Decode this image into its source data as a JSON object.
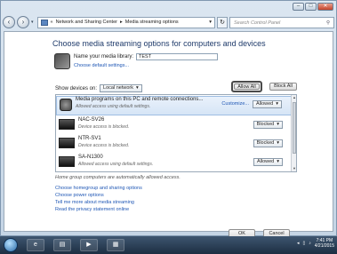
{
  "breadcrumb": {
    "sep": "«",
    "items": [
      "Network and Sharing Center",
      "Media streaming options"
    ],
    "arrow": "▸"
  },
  "search": {
    "placeholder": "Search Control Panel"
  },
  "heading": "Choose media streaming options for computers and devices",
  "library": {
    "label": "Name your media library:",
    "value": "TEST",
    "defaults_link": "Choose default settings..."
  },
  "show_devices": {
    "label": "Show devices on:",
    "value": "Local network"
  },
  "buttons": {
    "allow_all": "Allow All",
    "block_all": "Block All",
    "ok": "OK",
    "cancel": "Cancel"
  },
  "devices": [
    {
      "name": "Media programs on this PC and remote connections...",
      "sub": "Allowed access using default settings.",
      "customize": "Customize...",
      "status": "Allowed"
    },
    {
      "name": "NAC-SV26",
      "sub": "Device access is blocked.",
      "status": "Blocked"
    },
    {
      "name": "NTR-SV1",
      "sub": "Device access is blocked.",
      "status": "Blocked"
    },
    {
      "name": "SA-N1300",
      "sub": "Allowed access using default settings.",
      "status": "Allowed"
    }
  ],
  "note": "Home group computers are automatically allowed access.",
  "links": [
    "Choose homegroup and sharing options",
    "Choose power options",
    "Tell me more about media streaming",
    "Read the privacy statement online"
  ],
  "clock": {
    "time": "7:41 PM",
    "date": "4/21/2015"
  },
  "icons": {
    "back": "back-arrow-icon",
    "forward": "forward-arrow-icon",
    "search": "magnifier-icon"
  }
}
